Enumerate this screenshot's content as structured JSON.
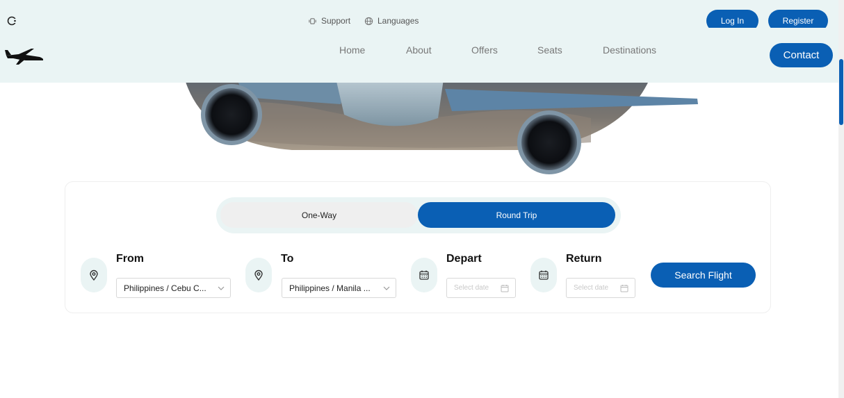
{
  "header": {
    "support_label": "Support",
    "languages_label": "Languages",
    "login_label": "Log In",
    "register_label": "Register",
    "contact_label": "Contact",
    "nav": [
      {
        "label": "Home"
      },
      {
        "label": "About"
      },
      {
        "label": "Offers"
      },
      {
        "label": "Seats"
      },
      {
        "label": "Destinations"
      }
    ]
  },
  "booking": {
    "trip_types": [
      {
        "label": "One-Way",
        "selected": false
      },
      {
        "label": "Round Trip",
        "selected": true
      }
    ],
    "from": {
      "label": "From",
      "value": "Philippines / Cebu C..."
    },
    "to": {
      "label": "To",
      "value": "Philippines / Manila ..."
    },
    "depart": {
      "label": "Depart",
      "placeholder": "Select date"
    },
    "return": {
      "label": "Return",
      "placeholder": "Select date"
    },
    "search_label": "Search Flight"
  },
  "colors": {
    "primary": "#0a5fb4",
    "header_bg": "#eaf4f4"
  }
}
